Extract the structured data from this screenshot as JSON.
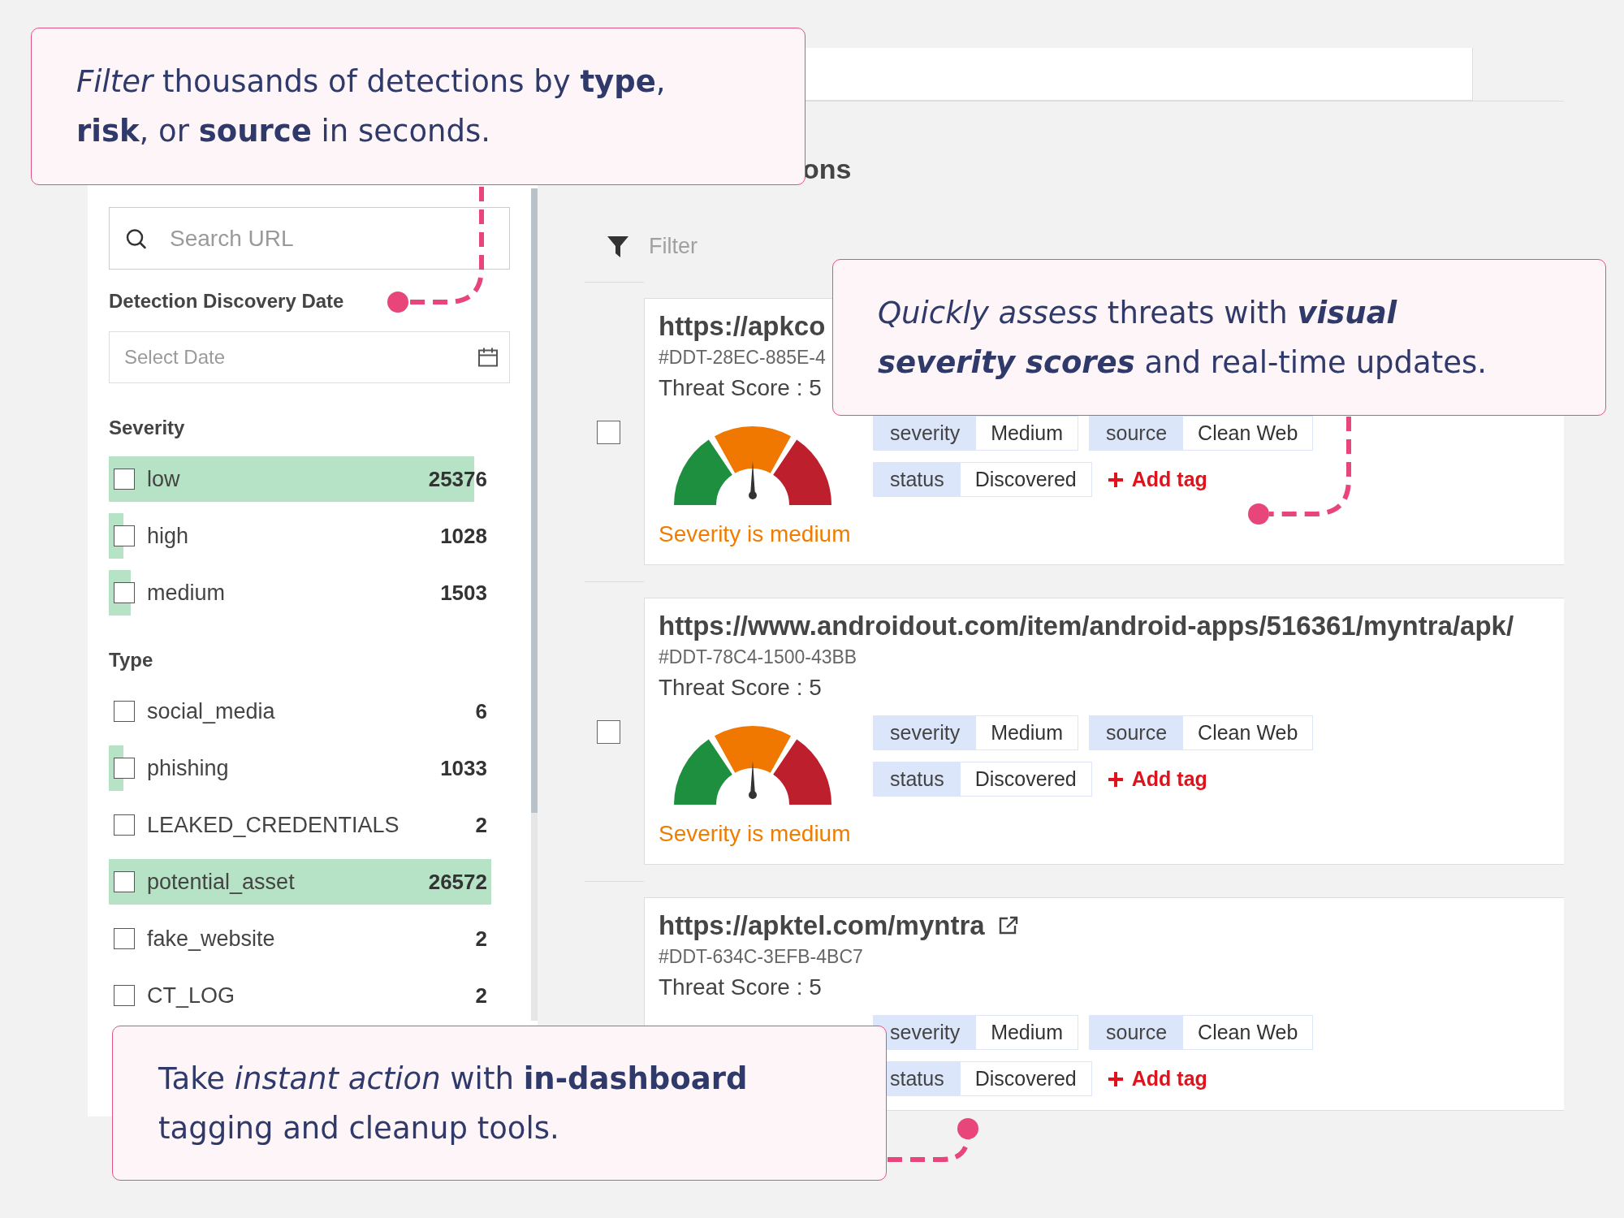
{
  "sidebar": {
    "search": {
      "placeholder": "Search URL"
    },
    "date_filter": {
      "label": "Detection Discovery Date",
      "placeholder": "Select Date"
    },
    "groups": [
      {
        "title": "Severity",
        "items": [
          {
            "label": "low",
            "count": "25376",
            "checked": false
          },
          {
            "label": "high",
            "count": "1028",
            "checked": false
          },
          {
            "label": "medium",
            "count": "1503",
            "checked": false
          }
        ]
      },
      {
        "title": "Type",
        "items": [
          {
            "label": "social_media",
            "count": "6",
            "checked": false
          },
          {
            "label": "phishing",
            "count": "1033",
            "checked": false
          },
          {
            "label": "LEAKED_CREDENTIALS",
            "count": "2",
            "checked": false
          },
          {
            "label": "potential_asset",
            "count": "26572",
            "checked": false
          },
          {
            "label": "fake_website",
            "count": "2",
            "checked": false
          },
          {
            "label": "CT_LOG",
            "count": "2",
            "checked": false
          }
        ]
      }
    ]
  },
  "main": {
    "heading": "ons",
    "filter": {
      "placeholder": "Filter"
    },
    "cards": [
      {
        "selected": false,
        "url": "https://apkco",
        "external_link": false,
        "id": "#DDT-28EC-885E-4",
        "score": "Threat Score : 5",
        "gauge": {
          "level": 0.5
        },
        "severity_text": "Severity is medium",
        "tags": [
          {
            "key": "severity",
            "value": "Medium"
          },
          {
            "key": "source",
            "value": "Clean Web"
          },
          {
            "key": "status",
            "value": "Discovered"
          }
        ],
        "add_tag": "Add tag"
      },
      {
        "selected": false,
        "url": "https://www.androidout.com/item/android-apps/516361/myntra/apk/",
        "external_link": false,
        "id": "#DDT-78C4-1500-43BB",
        "score": "Threat Score : 5",
        "gauge": {
          "level": 0.5
        },
        "severity_text": "Severity is medium",
        "tags": [
          {
            "key": "severity",
            "value": "Medium"
          },
          {
            "key": "source",
            "value": "Clean Web"
          },
          {
            "key": "status",
            "value": "Discovered"
          }
        ],
        "add_tag": "Add tag"
      },
      {
        "url": "https://apktel.com/myntra",
        "external_link": true,
        "id": "#DDT-634C-3EFB-4BC7",
        "score": "Threat Score : 5",
        "tags": [
          {
            "key": "severity",
            "value": "Medium"
          },
          {
            "key": "source",
            "value": "Clean Web"
          },
          {
            "key": "status",
            "value": "Discovered"
          }
        ],
        "add_tag": "Add tag"
      }
    ]
  },
  "callouts": [
    {
      "segments": [
        {
          "text": "Filter",
          "kind": "italic"
        },
        {
          "text": " thousands of detections by ",
          "kind": "plain"
        },
        {
          "text": "type",
          "kind": "bold"
        },
        {
          "text": ", ",
          "kind": "plain"
        },
        {
          "text": "risk",
          "kind": "bold"
        },
        {
          "text": ", or ",
          "kind": "plain"
        },
        {
          "text": "source",
          "kind": "bold"
        },
        {
          "text": " in seconds.",
          "kind": "plain"
        }
      ]
    },
    {
      "segments": [
        {
          "text": "Quickly assess",
          "kind": "italic"
        },
        {
          "text": " threats with ",
          "kind": "plain"
        },
        {
          "text": "visual severity scores",
          "kind": "bold-italic"
        },
        {
          "text": " and real-time updates.",
          "kind": "plain"
        }
      ]
    },
    {
      "segments": [
        {
          "text": "Take ",
          "kind": "plain"
        },
        {
          "text": "instant action",
          "kind": "italic"
        },
        {
          "text": " with ",
          "kind": "plain"
        },
        {
          "text": "in-dashboard",
          "kind": "bold"
        },
        {
          "text": " tagging and cleanup tools.",
          "kind": "plain"
        }
      ]
    }
  ]
}
